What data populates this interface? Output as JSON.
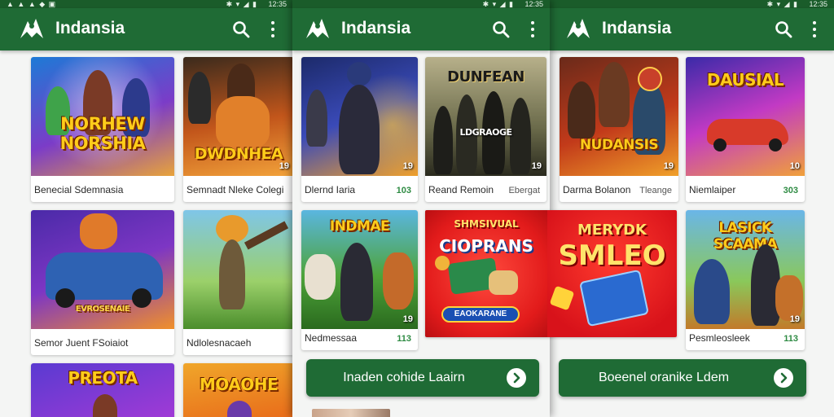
{
  "app": {
    "title": "Indansia"
  },
  "status": {
    "time": "12:35",
    "icons": "✱ ▾ ◢ ▮",
    "left": "▲ ▲ ▲ ◆ ▣"
  },
  "colors": {
    "appbar": "#1f6b35",
    "statusbar": "#1a5c2a",
    "accent_text": "#2e8b43"
  },
  "panels": [
    {
      "cards": [
        {
          "title": "Benecial Sdemnasia",
          "meta": "",
          "art_text": "NORHEW NORSHIA",
          "rating": ""
        },
        {
          "title": "Semnadt Nleke Colegi",
          "meta": "",
          "art_text": "DWDNHEA",
          "rating": "19"
        },
        {
          "title": "Semor Juent FSoiaiot",
          "meta": "",
          "art_text": "EVROSENAIE",
          "rating": ""
        },
        {
          "title": "Ndlolesnacaeh",
          "meta": "",
          "art_text": "",
          "rating": ""
        },
        {
          "title": "",
          "meta": "",
          "art_text": "PREOTA",
          "rating": ""
        },
        {
          "title": "",
          "meta": "",
          "art_text": "MOAOHE",
          "rating": ""
        }
      ]
    },
    {
      "cards": [
        {
          "title": "Dlernd Iaria",
          "meta": "103",
          "art_text": "",
          "rating": "19"
        },
        {
          "title": "Reand Remoin",
          "meta": "Ebergat",
          "art_text": "DUNFEAN",
          "sub_text": "LDGRAOGE",
          "rating": "19"
        },
        {
          "title": "Nedmessaa",
          "meta": "113",
          "art_text": "INDMAE",
          "rating": "19"
        }
      ],
      "promo": {
        "left_title": "SHMSIVUAL",
        "left_main": "CIOPRANS",
        "left_tag": "EAOKARANE",
        "right_top": "MERYDK",
        "right_main": "SMLEO"
      },
      "cta": {
        "label": "Inaden cohide Laairn"
      },
      "bottom_peek": true
    },
    {
      "cards": [
        {
          "title": "Darma Bolanon",
          "meta": "Tleange",
          "art_text": "NUDANSIS",
          "rating": "19"
        },
        {
          "title": "Niemlaiper",
          "meta": "303",
          "art_text": "DAUSIAL",
          "rating": "10"
        },
        {
          "title": "Pesmleosleek",
          "meta": "113",
          "art_text": "LASICK SCAAMA",
          "rating": "19"
        }
      ],
      "cta": {
        "label": "Boeenel oranike Ldem"
      }
    }
  ]
}
